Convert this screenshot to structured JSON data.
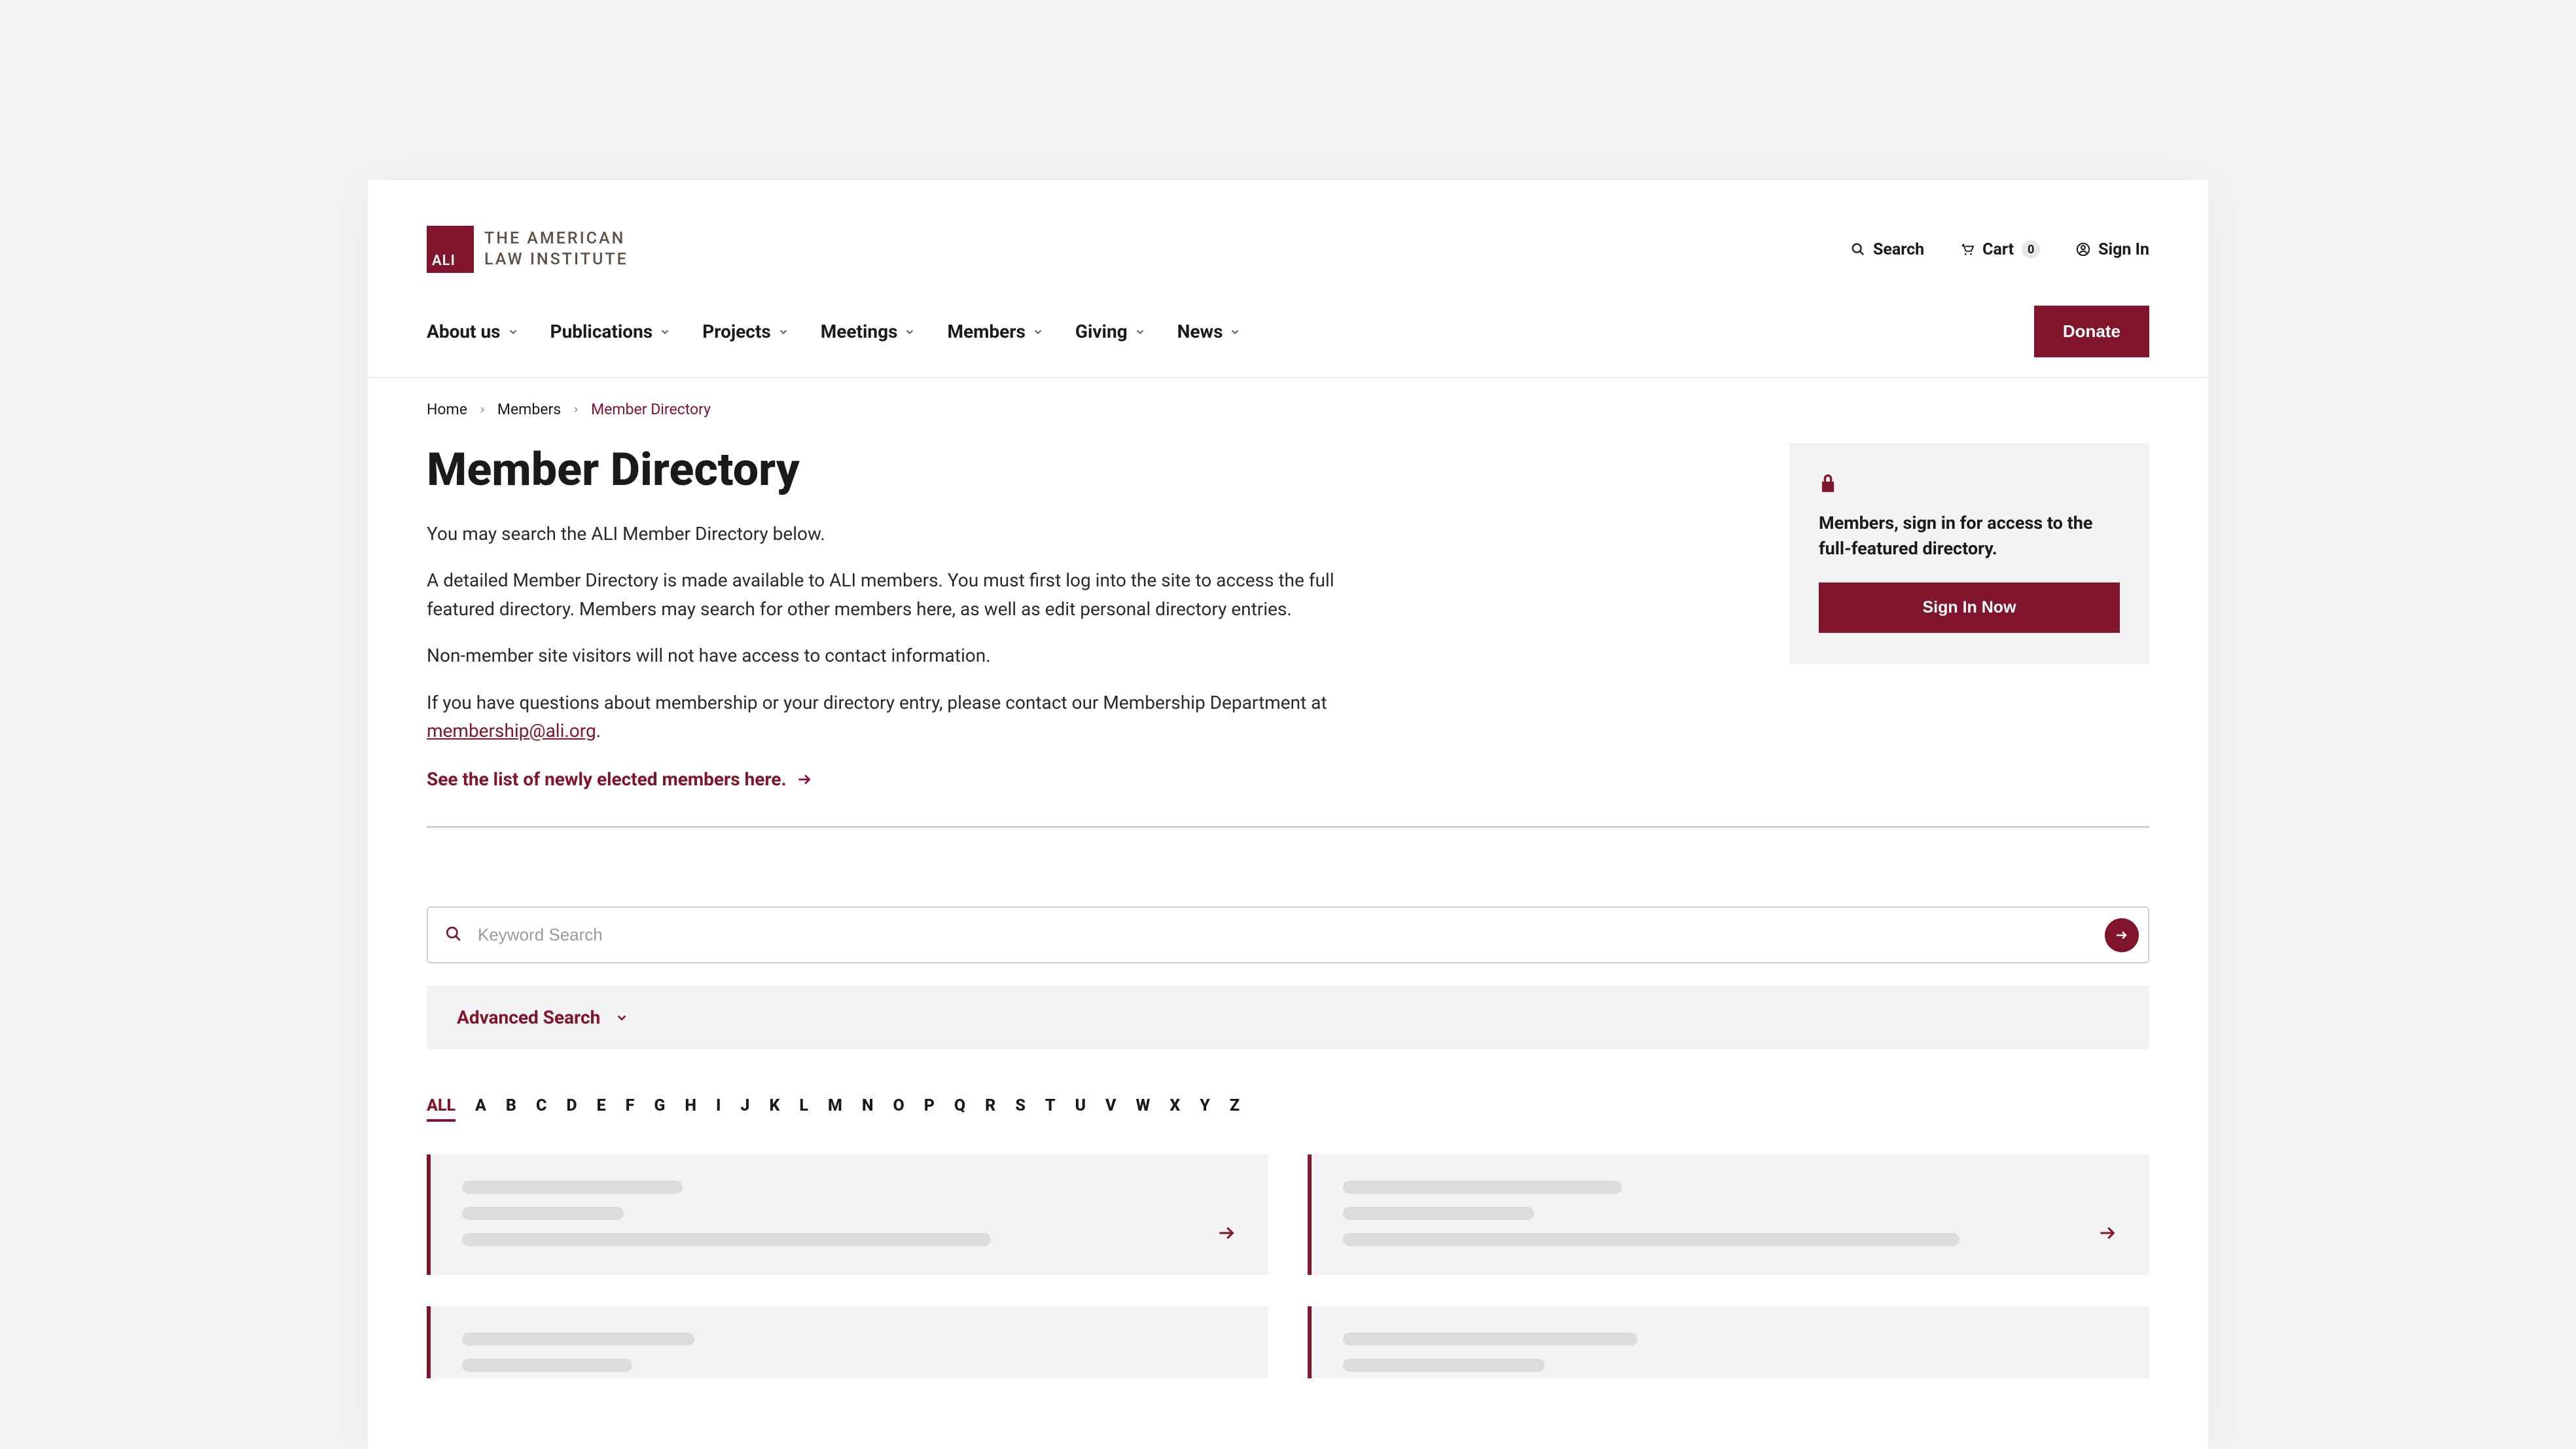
{
  "logo": {
    "mark": "ALI",
    "line1": "THE AMERICAN",
    "line2": "LAW INSTITUTE"
  },
  "header_utils": {
    "search": "Search",
    "cart": "Cart",
    "cart_count": "0",
    "signin": "Sign In"
  },
  "nav": {
    "items": [
      "About us",
      "Publications",
      "Projects",
      "Meetings",
      "Members",
      "Giving",
      "News"
    ],
    "donate": "Donate"
  },
  "breadcrumb": {
    "items": [
      "Home",
      "Members"
    ],
    "current": "Member Directory"
  },
  "page": {
    "title": "Member Directory",
    "p1": "You may search the ALI Member Directory below.",
    "p2": "A detailed Member Directory is made available to ALI members. You must first log into the site to access the full featured directory. Members may search for other members here, as well as edit personal directory entries.",
    "p3": "Non-member site visitors will not have access to contact information.",
    "p4_pre": "If you have questions about membership or your directory entry, please contact our Membership Department at ",
    "p4_email": "membership@ali.org",
    "p4_post": ".",
    "see_link": "See the list of newly elected members here."
  },
  "sidebar": {
    "message": "Members, sign in for access to the full-featured directory.",
    "button": "Sign In Now"
  },
  "search": {
    "placeholder": "Keyword Search",
    "advanced": "Advanced Search"
  },
  "alpha": {
    "all": "ALL",
    "letters": [
      "A",
      "B",
      "C",
      "D",
      "E",
      "F",
      "G",
      "H",
      "I",
      "J",
      "K",
      "L",
      "M",
      "N",
      "O",
      "P",
      "Q",
      "R",
      "S",
      "T",
      "U",
      "V",
      "W",
      "X",
      "Y",
      "Z"
    ]
  },
  "colors": {
    "brand": "#80152b"
  }
}
